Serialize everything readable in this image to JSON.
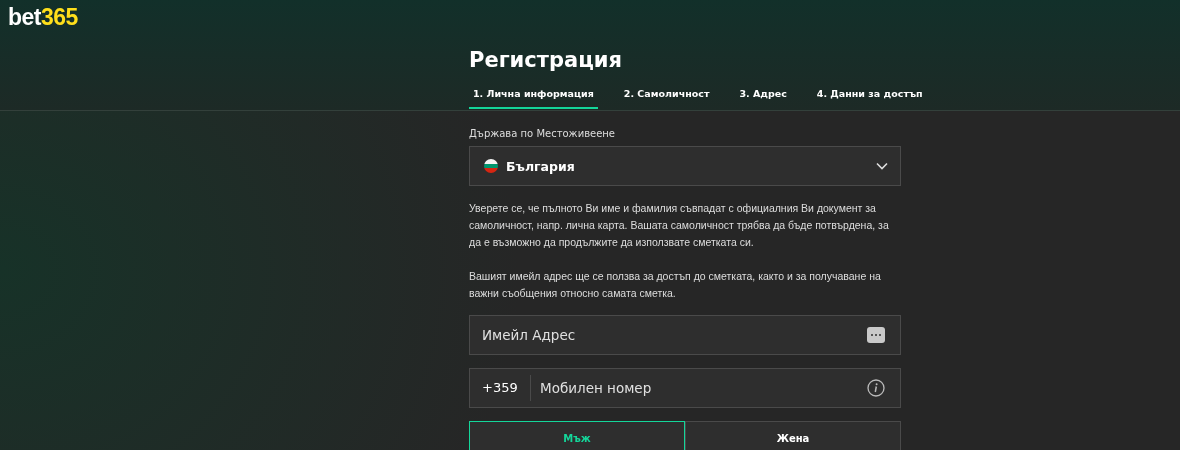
{
  "logo": {
    "brand": "bet",
    "accent": "365"
  },
  "title": "Регистрация",
  "tabs": [
    {
      "label": "1. Лична информация",
      "selected": true
    },
    {
      "label": "2. Самоличност",
      "selected": false
    },
    {
      "label": "3. Адрес",
      "selected": false
    },
    {
      "label": "4. Данни за достъп",
      "selected": false
    }
  ],
  "country": {
    "label": "Държава по Местоживеене",
    "value": "България"
  },
  "notes": [
    "Уверете се, че пълното Ви име и фамилия съвпадат с официалния Ви документ за самоличност, напр. лична карта. Вашата самоличност трябва да бъде потвърдена, за да е възможно да продължите да използвате сметката си.",
    "Вашият имейл адрес ще се ползва за достъп до сметката, както и за получаване на важни съобщения относно самата сметка."
  ],
  "email": {
    "placeholder": "Имейл Адрес"
  },
  "phone": {
    "prefix": "+359",
    "placeholder": "Мобилен номер"
  },
  "gender": [
    {
      "label": "Мъж",
      "selected": true
    },
    {
      "label": "Жена",
      "selected": false
    }
  ]
}
